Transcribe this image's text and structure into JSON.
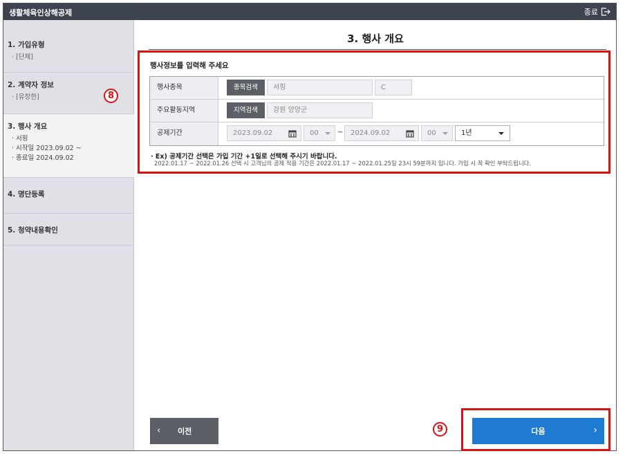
{
  "titlebar": {
    "app_title": "생활체육인상해공제",
    "exit_label": "종료"
  },
  "sidebar": {
    "steps": [
      {
        "label": "1. 가입유형",
        "subs": [
          "· [단체]"
        ]
      },
      {
        "label": "2. 계약자 정보",
        "subs": [
          "· [유창한]"
        ]
      },
      {
        "label": "3. 행사 개요",
        "subs": [
          "· 서핑",
          "· 시작일 2023.09.02 ~",
          "· 종료일 2024.09.02"
        ]
      },
      {
        "label": "4. 명단등록",
        "subs": []
      },
      {
        "label": "5. 청약내용확인",
        "subs": []
      }
    ]
  },
  "annotations": {
    "badge_8": "8",
    "badge_9": "9"
  },
  "main": {
    "title": "3. 행사 개요",
    "form_heading": "행사정보를 입력해 주세요",
    "rows": {
      "event_type": {
        "label": "행사종목",
        "search_btn": "종목검색",
        "value": "서핑",
        "code": "C"
      },
      "region": {
        "label": "주요활동지역",
        "search_btn": "지역검색",
        "value": "강원 양양군"
      },
      "period": {
        "label": "공제기간",
        "start_date": "2023.09.02",
        "start_hour": "00",
        "separator": "~",
        "end_date": "2024.09.02",
        "end_hour": "00",
        "duration": "1년"
      }
    },
    "note_bold": "· Ex) 공제기간 선택은 가입 기간 +1일로 선택해 주시기 바랍니다.",
    "note_detail": "2022.01.17 ~ 2022.01.26 선택 시 고객님의 공제 적용 기간은 2022.01.17 ~ 2022.01.25일 23시 59분까지 입니다. 가입 시 꼭 확인 부탁드립니다.",
    "prev_label": "이전",
    "next_label": "다음"
  },
  "colors": {
    "accent": "#1f7ad1",
    "highlight": "#e01010",
    "titlebar": "#3e4350"
  }
}
